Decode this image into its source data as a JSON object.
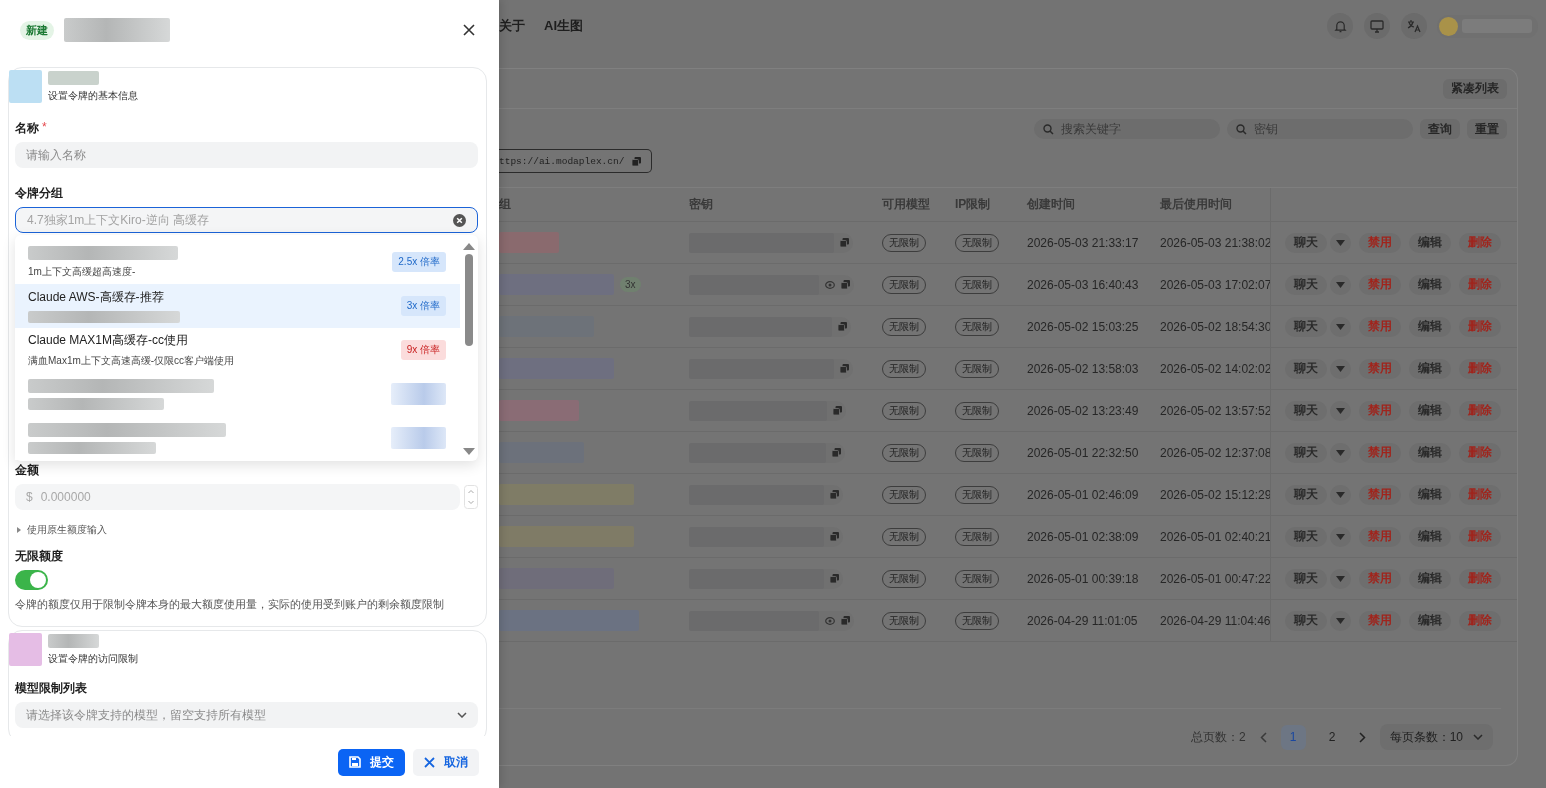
{
  "drawer": {
    "badge": "新建",
    "basic_section": {
      "subtitle": "设置令牌的基本信息",
      "name_field": {
        "label": "名称",
        "required_mark": "*",
        "placeholder": "请输入名称"
      },
      "group_field": {
        "label": "令牌分组",
        "placeholder": "4.7独家1m上下文Kiro-逆向 高缓存",
        "expanded": true,
        "options": [
          {
            "description": "1m上下文高缓超高速度-",
            "badge": "2.5x 倍率",
            "color": "#d6e6fb",
            "selected": false
          },
          {
            "name": "Claude AWS-高缓存-推荐",
            "badge": "3x 倍率",
            "color": "#d6e6fb",
            "selected": true
          },
          {
            "name": "Claude MAX1M高缓存-cc使用",
            "description": "满血Max1m上下文高速高缓-仅限cc客户端使用",
            "badge": "9x 倍率",
            "color": "#fbdcdc",
            "selected": false
          },
          {
            "selected": false
          },
          {
            "selected": false
          }
        ]
      },
      "amount_field": {
        "label": "金额",
        "prefix": "$",
        "value": "0.000000",
        "disabled": true
      },
      "native_toggle": {
        "label": "使用原生额度输入",
        "expanded": false
      },
      "unlimited": {
        "label": "无限额度",
        "on": true,
        "help": "令牌的额度仅用于限制令牌本身的最大额度使用量，实际的使用受到账户的剩余额度限制"
      }
    },
    "access_section": {
      "subtitle": "设置令牌的访问限制",
      "model_field": {
        "label": "模型限制列表",
        "placeholder": "请选择该令牌支持的模型，留空支持所有模型"
      }
    },
    "buttons": [
      {
        "label": "提交",
        "kind": "primary"
      },
      {
        "label": "取消",
        "kind": "secondary"
      }
    ]
  },
  "page": {
    "nav": [
      "关于",
      "AI生图"
    ],
    "compact_button": "紧凑列表",
    "search": [
      {
        "placeholder": "搜索关键字"
      },
      {
        "placeholder": "密钥"
      }
    ],
    "buttons": [
      "查询",
      "重置"
    ],
    "url": "ttps://ai.modaplex.cn/",
    "table": {
      "columns": [
        "组",
        "密钥",
        "可用模型",
        "IP限制",
        "创建时间",
        "最后使用时间"
      ],
      "rows": [
        {
          "eye": false,
          "models": "无限制",
          "ip": "无限制",
          "created": "2026-05-03 21:33:17",
          "last_used": "2026-05-03 21:38:02",
          "actions": [
            {
              "label": "聊天",
              "kind": "split"
            },
            {
              "label": "禁用",
              "kind": "danger"
            },
            {
              "label": "编辑",
              "kind": "plain"
            },
            {
              "label": "删除",
              "kind": "danger"
            }
          ]
        },
        {
          "ratio": "3x",
          "eye": true,
          "models": "无限制",
          "ip": "无限制",
          "created": "2026-05-03 16:40:43",
          "last_used": "2026-05-03 17:02:07",
          "actions": [
            {
              "label": "聊天",
              "kind": "split"
            },
            {
              "label": "禁用",
              "kind": "danger"
            },
            {
              "label": "编辑",
              "kind": "plain"
            },
            {
              "label": "删除",
              "kind": "danger"
            }
          ]
        },
        {
          "eye": false,
          "models": "无限制",
          "ip": "无限制",
          "created": "2026-05-02 15:03:25",
          "last_used": "2026-05-02 18:54:30",
          "actions": [
            {
              "label": "聊天",
              "kind": "split"
            },
            {
              "label": "禁用",
              "kind": "danger"
            },
            {
              "label": "编辑",
              "kind": "plain"
            },
            {
              "label": "删除",
              "kind": "danger"
            }
          ]
        },
        {
          "eye": false,
          "models": "无限制",
          "ip": "无限制",
          "created": "2026-05-02 13:58:03",
          "last_used": "2026-05-02 14:02:02",
          "actions": [
            {
              "label": "聊天",
              "kind": "split"
            },
            {
              "label": "禁用",
              "kind": "danger"
            },
            {
              "label": "编辑",
              "kind": "plain"
            },
            {
              "label": "删除",
              "kind": "danger"
            }
          ]
        },
        {
          "eye": false,
          "models": "无限制",
          "ip": "无限制",
          "created": "2026-05-02 13:23:49",
          "last_used": "2026-05-02 13:57:52",
          "actions": [
            {
              "label": "聊天",
              "kind": "split"
            },
            {
              "label": "禁用",
              "kind": "danger"
            },
            {
              "label": "编辑",
              "kind": "plain"
            },
            {
              "label": "删除",
              "kind": "danger"
            }
          ]
        },
        {
          "eye": false,
          "models": "无限制",
          "ip": "无限制",
          "created": "2026-05-01 22:32:50",
          "last_used": "2026-05-02 12:37:08",
          "actions": [
            {
              "label": "聊天",
              "kind": "split"
            },
            {
              "label": "禁用",
              "kind": "danger"
            },
            {
              "label": "编辑",
              "kind": "plain"
            },
            {
              "label": "删除",
              "kind": "danger"
            }
          ]
        },
        {
          "eye": false,
          "models": "无限制",
          "ip": "无限制",
          "created": "2026-05-01 02:46:09",
          "last_used": "2026-05-02 15:12:29",
          "actions": [
            {
              "label": "聊天",
              "kind": "split"
            },
            {
              "label": "禁用",
              "kind": "danger"
            },
            {
              "label": "编辑",
              "kind": "plain"
            },
            {
              "label": "删除",
              "kind": "danger"
            }
          ]
        },
        {
          "eye": false,
          "models": "无限制",
          "ip": "无限制",
          "created": "2026-05-01 02:38:09",
          "last_used": "2026-05-01 02:40:21",
          "actions": [
            {
              "label": "聊天",
              "kind": "split"
            },
            {
              "label": "禁用",
              "kind": "danger"
            },
            {
              "label": "编辑",
              "kind": "plain"
            },
            {
              "label": "删除",
              "kind": "danger"
            }
          ]
        },
        {
          "eye": false,
          "models": "无限制",
          "ip": "无限制",
          "created": "2026-05-01 00:39:18",
          "last_used": "2026-05-01 00:47:22",
          "actions": [
            {
              "label": "聊天",
              "kind": "split"
            },
            {
              "label": "禁用",
              "kind": "danger"
            },
            {
              "label": "编辑",
              "kind": "plain"
            },
            {
              "label": "删除",
              "kind": "danger"
            }
          ]
        },
        {
          "eye": true,
          "models": "无限制",
          "ip": "无限制",
          "created": "2026-04-29 11:01:05",
          "last_used": "2026-04-29 11:04:46",
          "actions": [
            {
              "label": "聊天",
              "kind": "split"
            },
            {
              "label": "禁用",
              "kind": "danger"
            },
            {
              "label": "编辑",
              "kind": "plain"
            },
            {
              "label": "删除",
              "kind": "danger"
            }
          ]
        }
      ]
    },
    "pagination": {
      "total": "总页数：2",
      "pages": [
        {
          "label": "1",
          "selected": true
        },
        {
          "label": "2",
          "selected": false
        }
      ],
      "page_size": "每页条数：10"
    }
  }
}
